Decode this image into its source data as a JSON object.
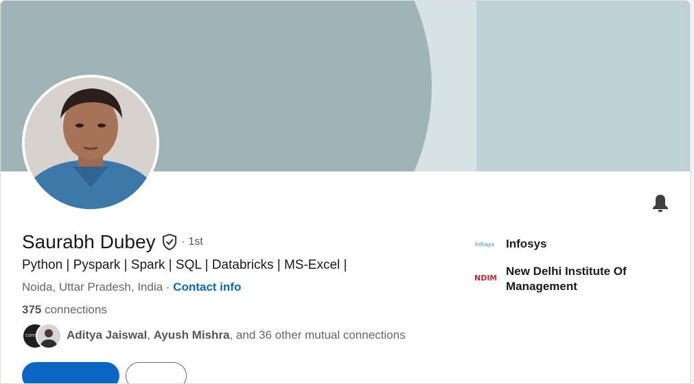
{
  "profile": {
    "name": "Saurabh Dubey",
    "degree": "· 1st",
    "headline": "Python | Pyspark | Spark | SQL | Databricks | MS-Excel |",
    "location": "Noida, Uttar Pradesh, India",
    "location_separator": " · ",
    "contact_info_label": "Contact info",
    "connections_count": "375",
    "connections_label": " connections"
  },
  "mutual": {
    "avatar1_text": "consu",
    "name1": "Aditya Jaiswal",
    "separator": ", ",
    "name2": "Ayush Mishra",
    "rest": ", and 36 other mutual connections"
  },
  "organizations": [
    {
      "name": "Infosys",
      "logo_text": "Infosys"
    },
    {
      "name": "New Delhi Institute Of Management",
      "logo_text": "NDIM"
    }
  ],
  "colors": {
    "accent": "#0a66c2",
    "banner_left": "#a0b3b6",
    "banner_mid": "#d7e2e5",
    "banner_right": "#bfd3d6"
  },
  "icons": {
    "bell": "bell-icon",
    "verified": "verified-shield-icon"
  }
}
